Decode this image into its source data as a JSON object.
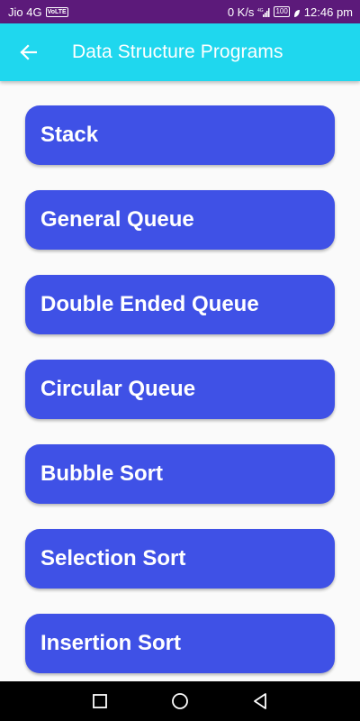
{
  "status_bar": {
    "carrier": "Jio 4G",
    "volte": "VoLTE",
    "speed": "0 K/s",
    "network": "4G",
    "battery": "100",
    "time": "12:46 pm",
    "background_color": "#5c1a7a"
  },
  "app_bar": {
    "title": "Data Structure Programs",
    "back_icon": "arrow-left-icon",
    "background_color": "#1fd7ee"
  },
  "programs": [
    "Stack",
    "General Queue",
    "Double Ended Queue",
    "Circular Queue",
    "Bubble Sort",
    "Selection Sort",
    "Insertion Sort"
  ],
  "button_color": "#3f51e6",
  "nav_bar": {
    "recents_icon": "square-icon",
    "home_icon": "circle-icon",
    "back_icon": "triangle-back-icon"
  }
}
